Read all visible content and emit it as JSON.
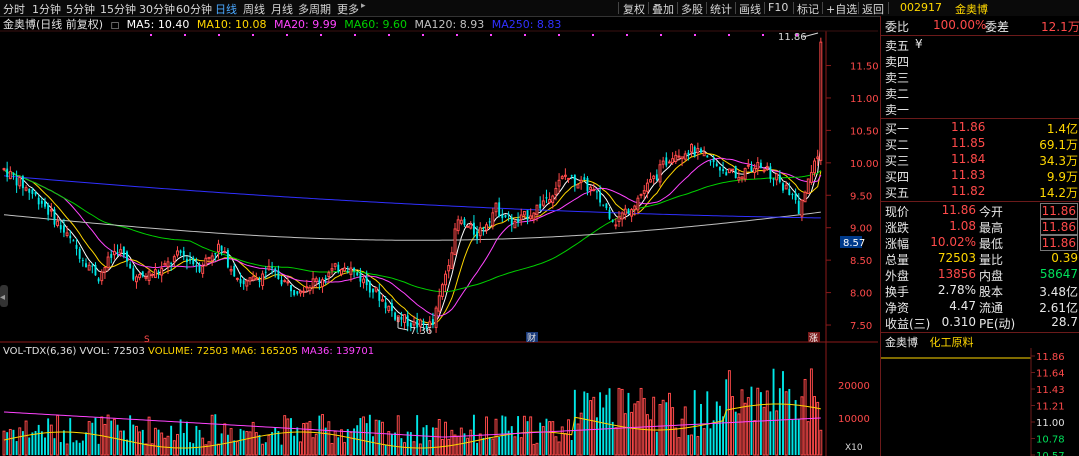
{
  "periods": [
    "分时",
    "1分钟",
    "5分钟",
    "15分钟",
    "30分钟",
    "60分钟",
    "日线",
    "周线",
    "月线",
    "多周期",
    "更多"
  ],
  "active_period": "日线",
  "toolbar": [
    "复权",
    "叠加",
    "多股",
    "统计",
    "画线",
    "F10",
    "标记",
    "+自选",
    "返回"
  ],
  "stock": {
    "code": "002917",
    "name": "金奥博"
  },
  "info_bar": {
    "name": "金奥博(日线 前复权)",
    "ma5": "MA5: 10.40",
    "ma10": "MA10: 10.08",
    "ma20": "MA20: 9.99",
    "ma60": "MA60: 9.60",
    "ma120": "MA120: 8.93",
    "ma250": "MA250: 8.83"
  },
  "colors": {
    "up": "#ff4a4a",
    "down": "#00e8e8",
    "ma5": "#ffffff",
    "ma10": "#ffd700",
    "ma20": "#ff44ff",
    "ma60": "#00d000",
    "ma120": "#c0c0c0",
    "ma250": "#3030ff"
  },
  "annotations": {
    "high": "11.86",
    "low": "7.36",
    "current_marker": "8.57",
    "s_marker": "S",
    "cai_marker": "财",
    "zhang_marker": "涨"
  },
  "vol_bar": {
    "title": "VOL-TDX(6,36)",
    "vvol": "VVOL: 72503",
    "volume": "VOLUME: 72503",
    "ma6": "MA6: 165205",
    "ma36": "MA36: 139701",
    "unit": "X10"
  },
  "chart_data": {
    "type": "candlestick",
    "price_axis": {
      "ticks": [
        "11.50",
        "11.00",
        "10.50",
        "10.00",
        "9.50",
        "9.00",
        "8.50",
        "8.00",
        "7.50"
      ],
      "range": [
        7.3,
        11.95
      ]
    },
    "volume_axis": {
      "ticks": [
        "20000",
        "10000"
      ]
    },
    "note": "Approximate daily bars read from the chart"
  },
  "order_book": {
    "weibi_label": "委比",
    "weibi_value": "100.00%",
    "weicha_label": "委差",
    "weicha_value": "12.1万",
    "asks": [
      {
        "label": "卖五",
        "price": "¥",
        "vol": ""
      },
      {
        "label": "卖四",
        "price": "",
        "vol": ""
      },
      {
        "label": "卖三",
        "price": "",
        "vol": ""
      },
      {
        "label": "卖二",
        "price": "",
        "vol": ""
      },
      {
        "label": "卖一",
        "price": "",
        "vol": ""
      }
    ],
    "bids": [
      {
        "label": "买一",
        "price": "11.86",
        "vol": "1.4亿"
      },
      {
        "label": "买二",
        "price": "11.85",
        "vol": "69.1万"
      },
      {
        "label": "买三",
        "price": "11.84",
        "vol": "34.3万"
      },
      {
        "label": "买四",
        "price": "11.83",
        "vol": "9.9万"
      },
      {
        "label": "买五",
        "price": "11.82",
        "vol": "14.2万"
      }
    ]
  },
  "quote": [
    {
      "l1": "现价",
      "v1": "11.86",
      "l2": "今开",
      "v2": "11.86"
    },
    {
      "l1": "涨跌",
      "v1": "1.08",
      "l2": "最高",
      "v2": "11.86"
    },
    {
      "l1": "涨幅",
      "v1": "10.02%",
      "l2": "最低",
      "v2": "11.86"
    },
    {
      "l1": "总量",
      "v1": "72503",
      "l2": "量比",
      "v2": "0.39"
    },
    {
      "l1": "外盘",
      "v1": "13856",
      "l2": "内盘",
      "v2": "58647"
    },
    {
      "l1": "换手",
      "v1": "2.78%",
      "l2": "股本",
      "v2": "3.48亿"
    },
    {
      "l1": "净资",
      "v1": "4.47",
      "l2": "流通",
      "v2": "2.61亿"
    },
    {
      "l1": "收益(三)",
      "v1": "0.310",
      "l2": "PE(动)",
      "v2": "28.7"
    }
  ],
  "intraday": {
    "tab1": "金奥博",
    "tab2": "化工原料",
    "ticks": [
      "11.86",
      "11.64",
      "11.43",
      "11.21",
      "11.00",
      "10.78",
      "10.57"
    ]
  }
}
